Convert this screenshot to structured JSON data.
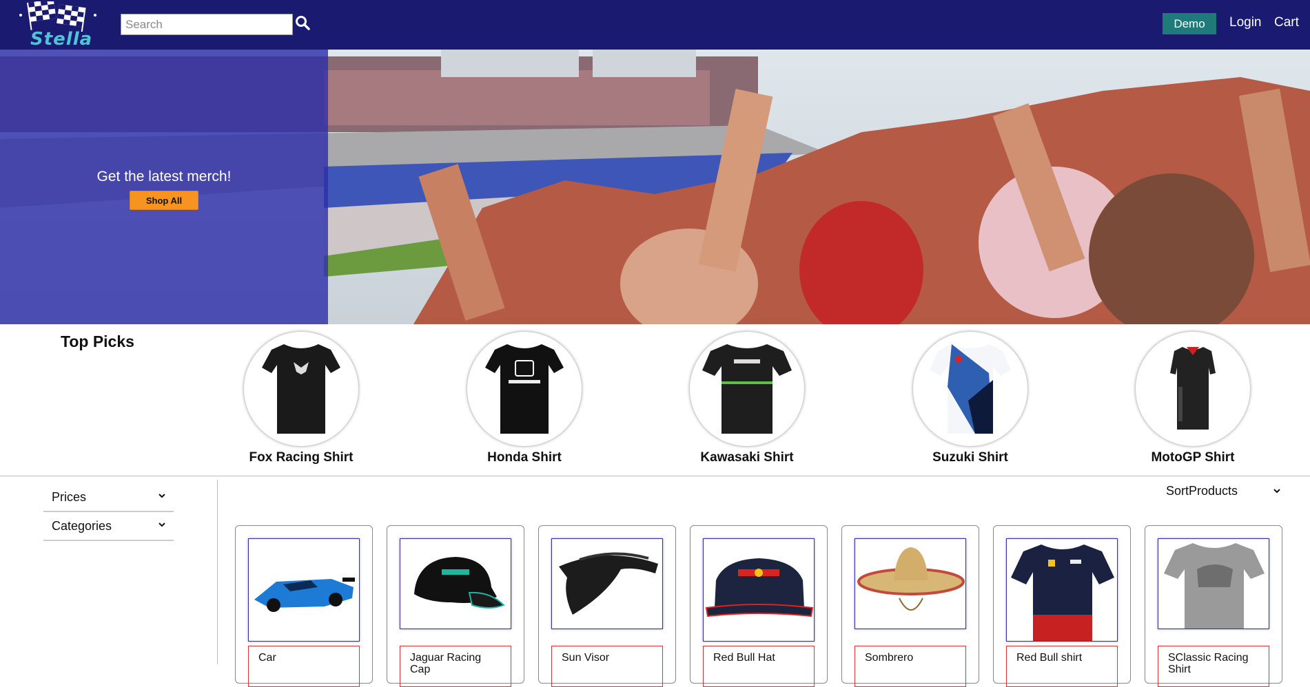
{
  "header": {
    "logo_text": "Stella",
    "search_placeholder": "Search",
    "demo_label": "Demo",
    "login_label": "Login",
    "cart_label": "Cart"
  },
  "hero": {
    "title": "Get the latest merch!",
    "button_label": "Shop All"
  },
  "top_picks": {
    "title": "Top Picks",
    "items": [
      {
        "label": "Fox Racing Shirt"
      },
      {
        "label": "Honda Shirt"
      },
      {
        "label": "Kawasaki Shirt"
      },
      {
        "label": "Suzuki Shirt"
      },
      {
        "label": "MotoGP Shirt"
      }
    ]
  },
  "filters": {
    "prices_label": "Prices",
    "categories_label": "Categories"
  },
  "sort": {
    "label": "SortProducts"
  },
  "products": [
    {
      "name": "Car"
    },
    {
      "name": "Jaguar Racing Cap"
    },
    {
      "name": "Sun Visor"
    },
    {
      "name": "Red Bull Hat"
    },
    {
      "name": "Sombrero"
    },
    {
      "name": "Red Bull shirt"
    },
    {
      "name": "SClassic Racing Shirt"
    }
  ],
  "colors": {
    "header_bg": "#1a1a70",
    "demo_bg": "#1f7a7a",
    "shop_all_bg": "#f79320",
    "hero_overlay": "#3030aa"
  },
  "icons": {
    "search": "search-icon",
    "chevron": "chevron-down-icon",
    "logo": "checkered-flags-icon"
  }
}
